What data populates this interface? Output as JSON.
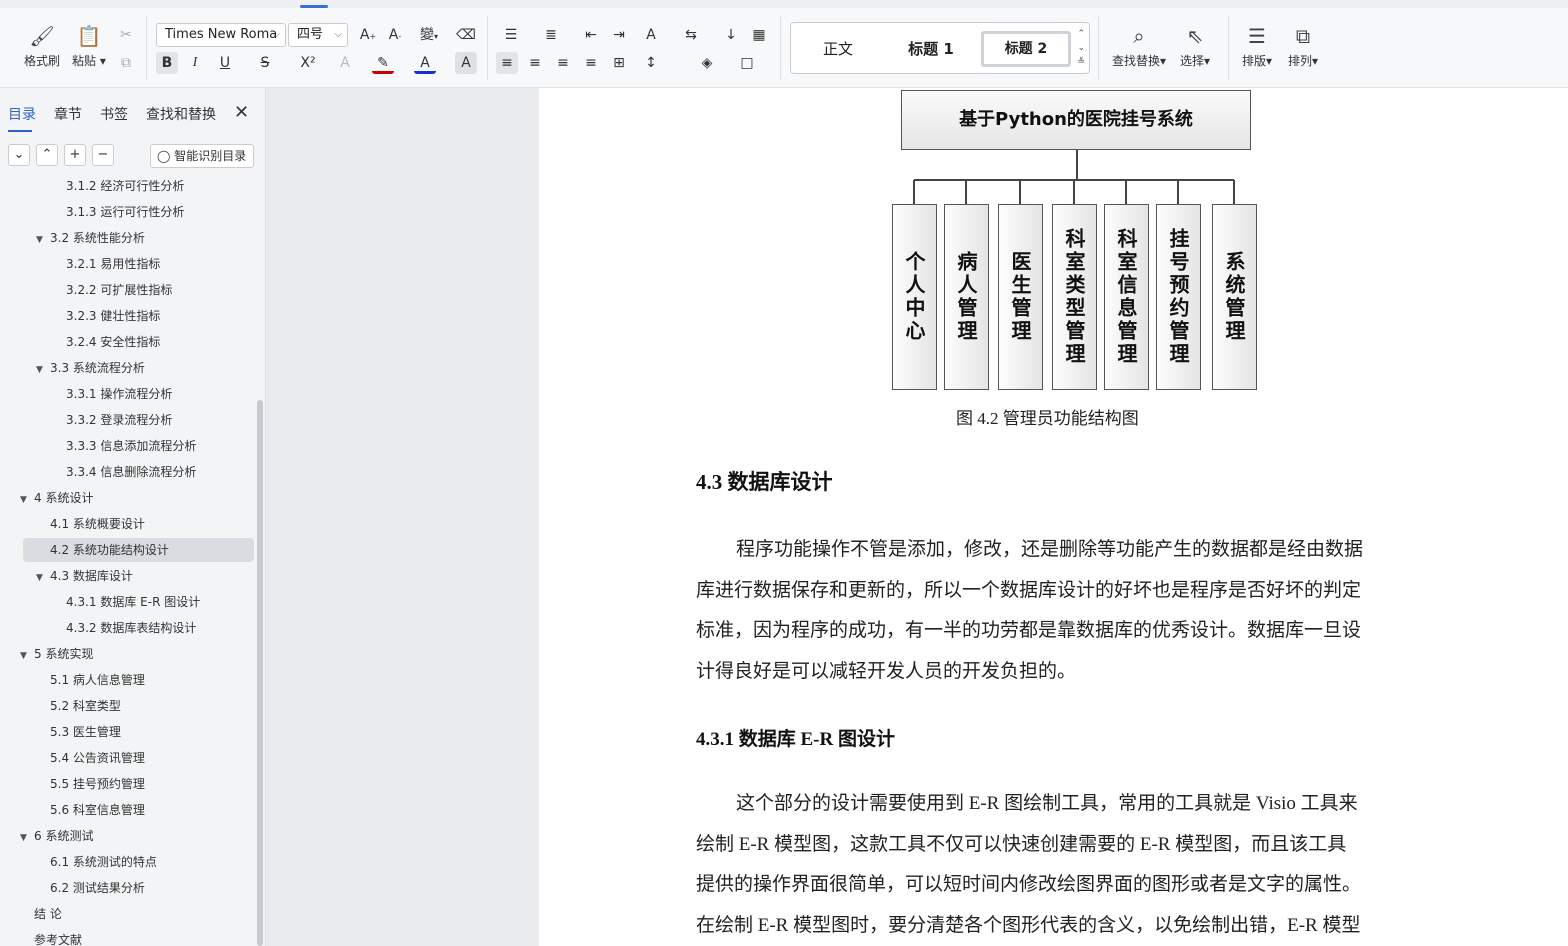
{
  "ribbon": {
    "format_painter": "格式刷",
    "paste": "粘贴",
    "font_name": "Times New Roma",
    "font_size": "四号",
    "find_replace": "查找替换",
    "select": "选择",
    "layout": "排版",
    "arrange": "排列",
    "styles": [
      "正文",
      "标题 1",
      "标题 2"
    ],
    "active_style": "标题 2",
    "bold": "B",
    "italic": "I",
    "underline": "U",
    "strike": "S",
    "superscript": "X²",
    "font_color": "#cc0000",
    "highlight_color": "#1a2fd0"
  },
  "sidebar": {
    "tabs": [
      "目录",
      "章节",
      "书签",
      "查找和替换"
    ],
    "active_tab": "目录",
    "smart_toc": "智能识别目录",
    "toc": [
      {
        "label": "3.1.2  经济可行性分析",
        "level": 3,
        "partial": true
      },
      {
        "label": "3.1.3  运行可行性分析",
        "level": 3
      },
      {
        "label": "3.2  系统性能分析",
        "level": 2,
        "expanded": true
      },
      {
        "label": "3.2.1  易用性指标",
        "level": 3
      },
      {
        "label": "3.2.2  可扩展性指标",
        "level": 3
      },
      {
        "label": "3.2.3  健壮性指标",
        "level": 3
      },
      {
        "label": "3.2.4  安全性指标",
        "level": 3
      },
      {
        "label": "3.3  系统流程分析",
        "level": 2,
        "expanded": true
      },
      {
        "label": "3.3.1  操作流程分析",
        "level": 3
      },
      {
        "label": "3.3.2  登录流程分析",
        "level": 3
      },
      {
        "label": "3.3.3  信息添加流程分析",
        "level": 3
      },
      {
        "label": "3.3.4  信息删除流程分析",
        "level": 3
      },
      {
        "label": "4  系统设计",
        "level": 1,
        "expanded": true
      },
      {
        "label": "4.1  系统概要设计",
        "level": 2
      },
      {
        "label": "4.2  系统功能结构设计",
        "level": 2,
        "selected": true
      },
      {
        "label": "4.3  数据库设计",
        "level": 2,
        "expanded": true
      },
      {
        "label": "4.3.1  数据库 E-R 图设计",
        "level": 3
      },
      {
        "label": "4.3.2  数据库表结构设计",
        "level": 3
      },
      {
        "label": "5  系统实现",
        "level": 1,
        "expanded": true
      },
      {
        "label": "5.1  病人信息管理",
        "level": 2
      },
      {
        "label": "5.2  科室类型",
        "level": 2
      },
      {
        "label": "5.3  医生管理",
        "level": 2
      },
      {
        "label": "5.4  公告资讯管理",
        "level": 2
      },
      {
        "label": "5.5  挂号预约管理",
        "level": 2
      },
      {
        "label": "5.6  科室信息管理",
        "level": 2
      },
      {
        "label": "6  系统测试",
        "level": 1,
        "expanded": true
      },
      {
        "label": "6.1  系统测试的特点",
        "level": 2
      },
      {
        "label": "6.2  测试结果分析",
        "level": 2
      },
      {
        "label": "结    论",
        "level": 1
      },
      {
        "label": "参考文献",
        "level": 1
      }
    ]
  },
  "document": {
    "diagram_root": "基于Python的医院挂号系统",
    "diagram_children": [
      "个人中心",
      "病人管理",
      "医生管理",
      "科室类型管理",
      "科室信息管理",
      "挂号预约管理",
      "系统管理"
    ],
    "figure_caption": "图 4.2  管理员功能结构图",
    "heading_43": "4.3  数据库设计",
    "para1_lines": [
      "程序功能操作不管是添加，修改，还是删除等功能产生的数据都是经由数据",
      "库进行数据保存和更新的，所以一个数据库设计的好坏也是程序是否好坏的判定",
      "标准，因为程序的成功，有一半的功劳都是靠数据库的优秀设计。数据库一旦设",
      "计得良好是可以减轻开发人员的开发负担的。"
    ],
    "heading_431": "4.3.1  数据库 E-R 图设计",
    "para2_lines": [
      "这个部分的设计需要使用到 E-R 图绘制工具，常用的工具就是 Visio 工具来",
      "绘制 E-R 模型图，这款工具不仅可以快速创建需要的 E-R 模型图，而且该工具",
      "提供的操作界面很简单，可以短时间内修改绘图界面的图形或者是文字的属性。",
      "在绘制 E-R 模型图时，要分清楚各个图形代表的含义，以免绘制出错，E-R 模型"
    ]
  }
}
